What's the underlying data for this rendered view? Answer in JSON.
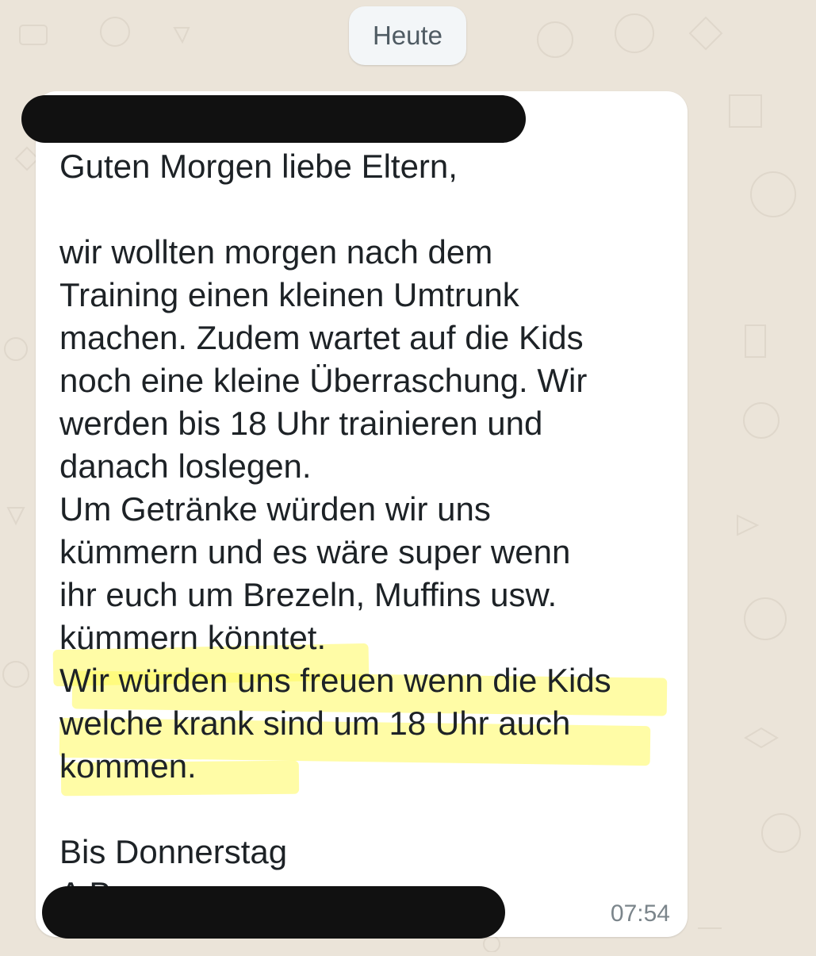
{
  "chat": {
    "date_label": "Heute"
  },
  "message": {
    "sender_name": "█████",
    "body": "Guten Morgen liebe Eltern,\n\nwir wollten morgen nach dem\nTraining einen kleinen Umtrunk\nmachen. Zudem wartet auf die Kids\nnoch eine kleine Überraschung. Wir\nwerden bis 18 Uhr trainieren und\ndanach loslegen.\nUm Getränke würden wir uns\nkümmern und es wäre super wenn\nihr euch um Brezeln, Muffins usw.\nkümmern könntet.\nWir würden uns freuen wenn die Kids\nwelche krank sind um 18 Uhr auch\nkommen.\n\nBis Donnerstag",
    "signature_partial": "A    B",
    "time": "07:54"
  },
  "colors": {
    "wallpaper": "#ebe4d9",
    "bubble": "#ffffff",
    "text": "#1d2226",
    "timestamp": "#7b858b",
    "highlight": "#fff85c",
    "redaction": "#111111"
  }
}
